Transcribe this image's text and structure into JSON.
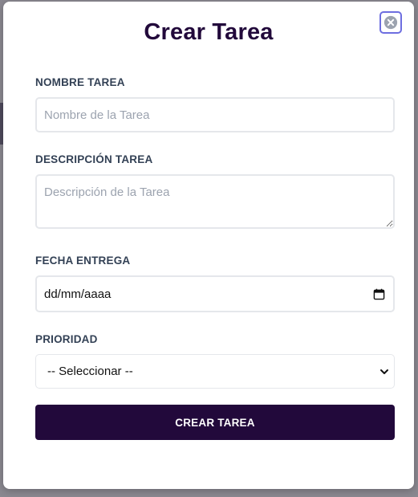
{
  "modal": {
    "title": "Crear Tarea",
    "fields": {
      "nombre": {
        "label": "NOMBRE TAREA",
        "placeholder": "Nombre de la Tarea",
        "value": ""
      },
      "descripcion": {
        "label": "DESCRIPCIÓN TAREA",
        "placeholder": "Descripción de la Tarea",
        "value": ""
      },
      "fecha": {
        "label": "FECHA ENTREGA",
        "value": "dd/mm/aaaa"
      },
      "prioridad": {
        "label": "PRIORIDAD",
        "selected": "-- Seleccionar --"
      }
    },
    "submit_label": "CREAR TAREA"
  },
  "icons": {
    "close": "close-icon",
    "calendar": "calendar-icon",
    "dropdown": "chevron-down-icon"
  },
  "colors": {
    "primary": "#22093b",
    "close_border": "#6d6ee0",
    "label": "#334155",
    "placeholder": "#9ca3af",
    "field_border": "#e5e7eb"
  }
}
